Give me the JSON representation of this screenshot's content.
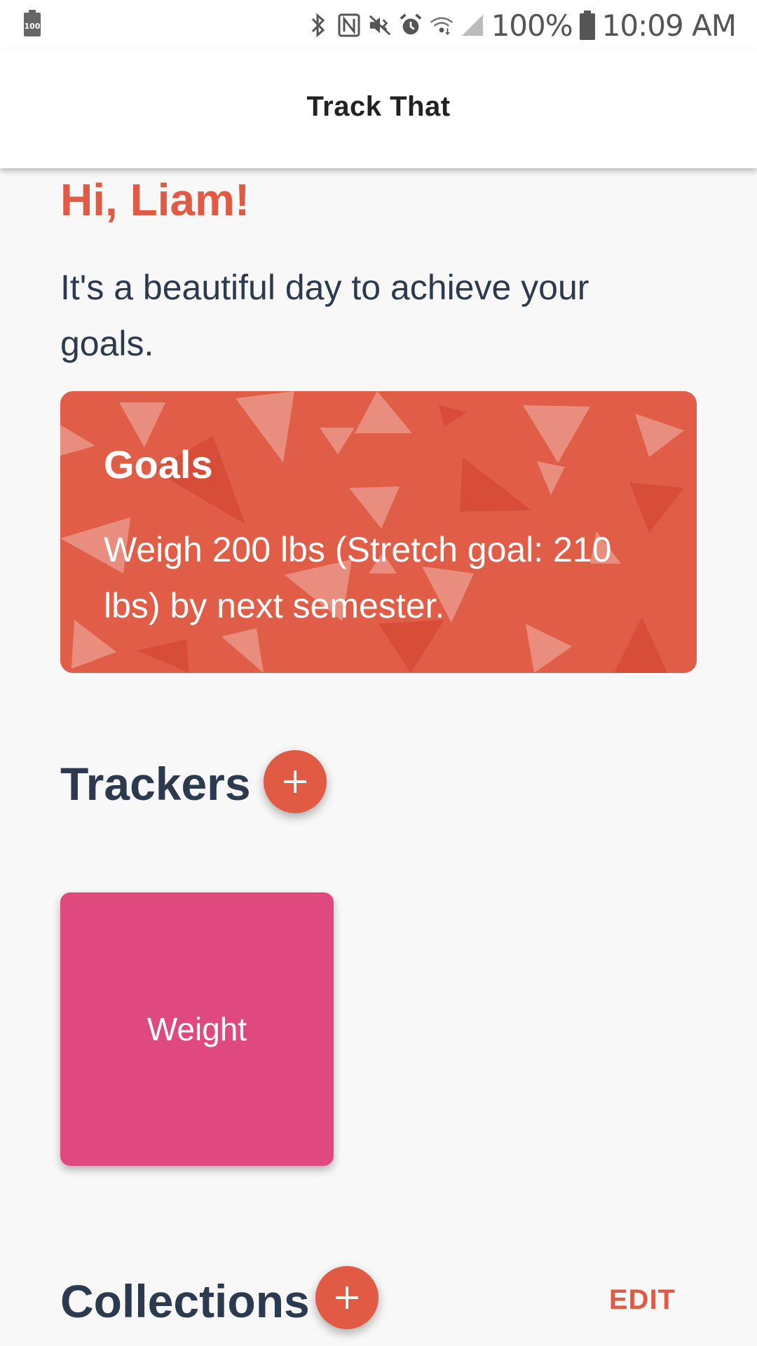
{
  "status_bar": {
    "left_battery_label": "100",
    "battery_percent": "100%",
    "time": "10:09 AM",
    "icons": [
      "bluetooth-icon",
      "nfc-icon",
      "vibrate-icon",
      "alarm-icon",
      "wifi-icon",
      "signal-icon",
      "battery-icon"
    ]
  },
  "app_bar": {
    "title": "Track That"
  },
  "greeting": {
    "title": "Hi, Liam!",
    "subtitle": "It's a beautiful day to achieve your goals."
  },
  "goals_card": {
    "title": "Goals",
    "text": "Weigh 200 lbs (Stretch goal: 210 lbs) by next semester."
  },
  "trackers": {
    "title": "Trackers",
    "items": [
      {
        "label": "Weight",
        "color": "#df497e"
      }
    ]
  },
  "collections": {
    "title": "Collections",
    "edit_label": "EDIT"
  },
  "colors": {
    "accent": "#e05a44",
    "text_dark": "#2b3a4f",
    "goals_card_bg": "#e05d47",
    "background": "#f8f8f8"
  }
}
